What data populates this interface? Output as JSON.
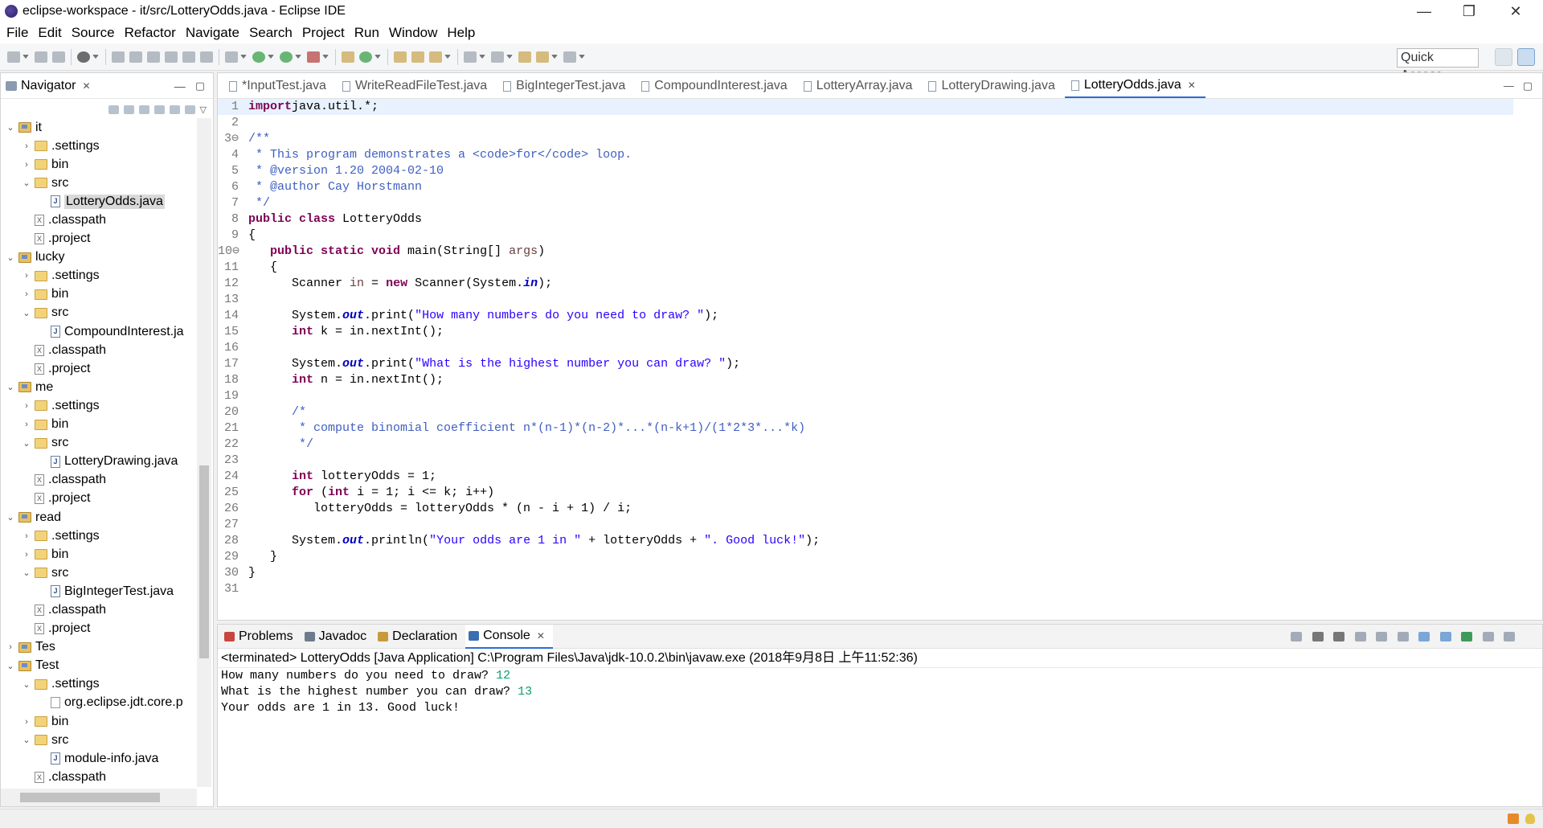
{
  "window": {
    "title": "eclipse-workspace - it/src/LotteryOdds.java - Eclipse IDE",
    "controls": {
      "minimize": "—",
      "restore": "❐",
      "close": "✕"
    }
  },
  "menu": [
    "File",
    "Edit",
    "Source",
    "Refactor",
    "Navigate",
    "Search",
    "Project",
    "Run",
    "Window",
    "Help"
  ],
  "toolbar": {
    "quick_access": "Quick Access"
  },
  "navigator": {
    "title": "Navigator",
    "rows": [
      {
        "label": "it",
        "depth": 0,
        "icon": "project-icon",
        "twisty": "v"
      },
      {
        "label": ".settings",
        "depth": 1,
        "icon": "folder-icon",
        "twisty": ">"
      },
      {
        "label": "bin",
        "depth": 1,
        "icon": "folder-icon",
        "twisty": ">"
      },
      {
        "label": "src",
        "depth": 1,
        "icon": "folder-icon",
        "twisty": "v"
      },
      {
        "label": "LotteryOdds.java",
        "depth": 2,
        "icon": "java-file-icon",
        "twisty": "",
        "selected": true
      },
      {
        "label": ".classpath",
        "depth": 1,
        "icon": "xml-file-icon",
        "twisty": ""
      },
      {
        "label": ".project",
        "depth": 1,
        "icon": "xml-file-icon",
        "twisty": ""
      },
      {
        "label": "lucky",
        "depth": 0,
        "icon": "project-icon",
        "twisty": "v"
      },
      {
        "label": ".settings",
        "depth": 1,
        "icon": "folder-icon",
        "twisty": ">"
      },
      {
        "label": "bin",
        "depth": 1,
        "icon": "folder-icon",
        "twisty": ">"
      },
      {
        "label": "src",
        "depth": 1,
        "icon": "folder-icon",
        "twisty": "v"
      },
      {
        "label": "CompoundInterest.ja",
        "depth": 2,
        "icon": "java-file-icon",
        "twisty": ""
      },
      {
        "label": ".classpath",
        "depth": 1,
        "icon": "xml-file-icon",
        "twisty": ""
      },
      {
        "label": ".project",
        "depth": 1,
        "icon": "xml-file-icon",
        "twisty": ""
      },
      {
        "label": "me",
        "depth": 0,
        "icon": "project-icon",
        "twisty": "v"
      },
      {
        "label": ".settings",
        "depth": 1,
        "icon": "folder-icon",
        "twisty": ">"
      },
      {
        "label": "bin",
        "depth": 1,
        "icon": "folder-icon",
        "twisty": ">"
      },
      {
        "label": "src",
        "depth": 1,
        "icon": "folder-icon",
        "twisty": "v"
      },
      {
        "label": "LotteryDrawing.java",
        "depth": 2,
        "icon": "java-file-icon",
        "twisty": ""
      },
      {
        "label": ".classpath",
        "depth": 1,
        "icon": "xml-file-icon",
        "twisty": ""
      },
      {
        "label": ".project",
        "depth": 1,
        "icon": "xml-file-icon",
        "twisty": ""
      },
      {
        "label": "read",
        "depth": 0,
        "icon": "project-icon",
        "twisty": "v"
      },
      {
        "label": ".settings",
        "depth": 1,
        "icon": "folder-icon",
        "twisty": ">"
      },
      {
        "label": "bin",
        "depth": 1,
        "icon": "folder-icon",
        "twisty": ">"
      },
      {
        "label": "src",
        "depth": 1,
        "icon": "folder-icon",
        "twisty": "v"
      },
      {
        "label": "BigIntegerTest.java",
        "depth": 2,
        "icon": "java-file-icon",
        "twisty": ""
      },
      {
        "label": ".classpath",
        "depth": 1,
        "icon": "xml-file-icon",
        "twisty": ""
      },
      {
        "label": ".project",
        "depth": 1,
        "icon": "xml-file-icon",
        "twisty": ""
      },
      {
        "label": "Tes",
        "depth": 0,
        "icon": "project-icon",
        "twisty": ">"
      },
      {
        "label": "Test",
        "depth": 0,
        "icon": "project-icon",
        "twisty": "v"
      },
      {
        "label": ".settings",
        "depth": 1,
        "icon": "folder-icon",
        "twisty": "v"
      },
      {
        "label": "org.eclipse.jdt.core.p",
        "depth": 2,
        "icon": "file-icon",
        "twisty": ""
      },
      {
        "label": "bin",
        "depth": 1,
        "icon": "folder-icon",
        "twisty": ">"
      },
      {
        "label": "src",
        "depth": 1,
        "icon": "folder-icon",
        "twisty": "v"
      },
      {
        "label": "module-info.java",
        "depth": 2,
        "icon": "java-file-icon",
        "twisty": ""
      },
      {
        "label": ".classpath",
        "depth": 1,
        "icon": "xml-file-icon",
        "twisty": ""
      }
    ]
  },
  "editor": {
    "tabs": [
      {
        "label": "*InputTest.java",
        "active": false
      },
      {
        "label": "WriteReadFileTest.java",
        "active": false
      },
      {
        "label": "BigIntegerTest.java",
        "active": false
      },
      {
        "label": "CompoundInterest.java",
        "active": false
      },
      {
        "label": "LotteryArray.java",
        "active": false
      },
      {
        "label": "LotteryDrawing.java",
        "active": false
      },
      {
        "label": "LotteryOdds.java",
        "active": true
      }
    ],
    "lines": [
      [
        [
          "kw",
          "import"
        ],
        [
          "",
          "java.util.*;"
        ]
      ],
      [],
      [
        [
          "cm",
          "/**"
        ]
      ],
      [
        [
          "cm",
          " * This program demonstrates a <code>for</code> loop."
        ]
      ],
      [
        [
          "cm",
          " * @version 1.20 2004-02-10"
        ]
      ],
      [
        [
          "cm",
          " * @author Cay Horstmann"
        ]
      ],
      [
        [
          "cm",
          " */"
        ]
      ],
      [
        [
          "kw",
          "public class"
        ],
        [
          "",
          " LotteryOdds"
        ]
      ],
      [
        [
          "",
          "{"
        ]
      ],
      [
        [
          "",
          "   "
        ],
        [
          "kw",
          "public static void"
        ],
        [
          "",
          " main(String[] "
        ],
        [
          "var",
          "args"
        ],
        [
          "",
          ")"
        ]
      ],
      [
        [
          "",
          "   {"
        ]
      ],
      [
        [
          "",
          "      Scanner "
        ],
        [
          "var",
          "in"
        ],
        [
          "",
          " = "
        ],
        [
          "kw",
          "new"
        ],
        [
          "",
          " Scanner(System."
        ],
        [
          "fld",
          "in"
        ],
        [
          "",
          ");"
        ]
      ],
      [],
      [
        [
          "",
          "      System."
        ],
        [
          "fld",
          "out"
        ],
        [
          "",
          ".print("
        ],
        [
          "str",
          "\"How many numbers do you need to draw? \""
        ],
        [
          "",
          ");"
        ]
      ],
      [
        [
          "",
          "      "
        ],
        [
          "kw",
          "int"
        ],
        [
          "",
          " k = in.nextInt();"
        ]
      ],
      [],
      [
        [
          "",
          "      System."
        ],
        [
          "fld",
          "out"
        ],
        [
          "",
          ".print("
        ],
        [
          "str",
          "\"What is the highest number you can draw? \""
        ],
        [
          "",
          ");"
        ]
      ],
      [
        [
          "",
          "      "
        ],
        [
          "kw",
          "int"
        ],
        [
          "",
          " n = in.nextInt();"
        ]
      ],
      [],
      [
        [
          "cm",
          "      /*"
        ]
      ],
      [
        [
          "cm",
          "       * compute binomial coefficient n*(n-1)*(n-2)*...*(n-k+1)/(1*2*3*...*k)"
        ]
      ],
      [
        [
          "cm",
          "       */"
        ]
      ],
      [],
      [
        [
          "",
          "      "
        ],
        [
          "kw",
          "int"
        ],
        [
          "",
          " lotteryOdds = 1;"
        ]
      ],
      [
        [
          "",
          "      "
        ],
        [
          "kw",
          "for"
        ],
        [
          "",
          " ("
        ],
        [
          "kw",
          "int"
        ],
        [
          "",
          " i = 1; i <= k; i++)"
        ]
      ],
      [
        [
          "",
          "         lotteryOdds = lotteryOdds * (n - i + 1) / i;"
        ]
      ],
      [],
      [
        [
          "",
          "      System."
        ],
        [
          "fld",
          "out"
        ],
        [
          "",
          ".println("
        ],
        [
          "str",
          "\"Your odds are 1 in \""
        ],
        [
          "",
          " + lotteryOdds + "
        ],
        [
          "str",
          "\". Good luck!\""
        ],
        [
          "",
          ");"
        ]
      ],
      [
        [
          "",
          "   }"
        ]
      ],
      [
        [
          "",
          "}"
        ]
      ],
      []
    ],
    "line_numbers": [
      "1",
      "2",
      "3⊖",
      "4",
      "5",
      "6",
      "7",
      "8",
      "9",
      "10⊖",
      "11",
      "12",
      "13",
      "14",
      "15",
      "16",
      "17",
      "18",
      "19",
      "20",
      "21",
      "22",
      "23",
      "24",
      "25",
      "26",
      "27",
      "28",
      "29",
      "30",
      "31"
    ]
  },
  "console": {
    "tabs": [
      {
        "label": "Problems",
        "icon": "problems-icon"
      },
      {
        "label": "Javadoc",
        "icon": "javadoc-icon"
      },
      {
        "label": "Declaration",
        "icon": "declaration-icon"
      },
      {
        "label": "Console",
        "icon": "console-icon",
        "active": true
      }
    ],
    "header": "<terminated> LotteryOdds [Java Application] C:\\Program Files\\Java\\jdk-10.0.2\\bin\\javaw.exe (2018年9月8日 上午11:52:36)",
    "output": [
      {
        "text": "How many numbers do you need to draw? ",
        "input": "12"
      },
      {
        "text": "What is the highest number you can draw? ",
        "input": "13"
      },
      {
        "text": "Your odds are 1 in 13. Good luck!",
        "input": ""
      }
    ]
  },
  "colors": {
    "accent": "#2a6fd3",
    "keyword": "#7f0055",
    "comment": "#3f5fbf",
    "string": "#2a00ff",
    "input": "#0aa06e"
  }
}
